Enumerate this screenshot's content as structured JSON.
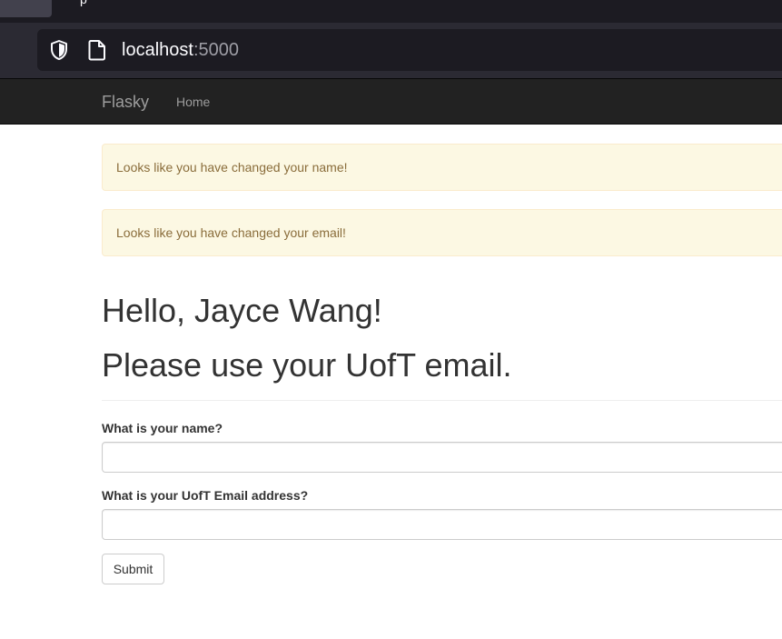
{
  "browser": {
    "tab_glyph": "p",
    "url_host": "localhost",
    "url_port": ":5000"
  },
  "navbar": {
    "brand": "Flasky",
    "links": [
      "Home"
    ]
  },
  "alerts": [
    "Looks like you have changed your name!",
    "Looks like you have changed your email!"
  ],
  "page": {
    "greeting": "Hello, Jayce Wang!",
    "notice": "Please use your UofT email."
  },
  "form": {
    "name_label": "What is your name?",
    "name_value": "",
    "email_label": "What is your UofT Email address?",
    "email_value": "",
    "submit_label": "Submit"
  },
  "colors": {
    "navbar_bg": "#222222",
    "alert_bg": "#fcf8e3",
    "alert_text": "#8a6d3b"
  }
}
